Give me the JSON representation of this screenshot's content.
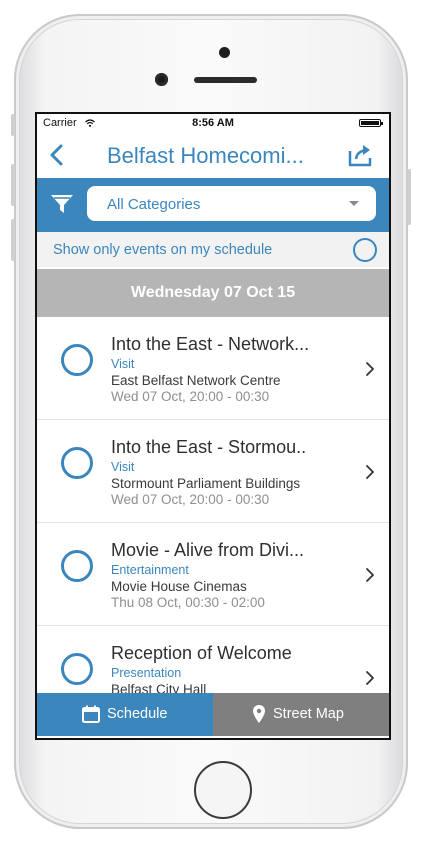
{
  "status_bar": {
    "carrier": "Carrier",
    "time": "8:56 AM"
  },
  "nav": {
    "title": "Belfast Homecomi...",
    "back_icon": "chevron-left-icon",
    "share_icon": "share-icon"
  },
  "filter": {
    "category": "All Categories",
    "icon": "funnel-icon"
  },
  "only_my_schedule": {
    "label": "Show only events on my schedule"
  },
  "date_header": "Wednesday 07 Oct 15",
  "events": [
    {
      "title": "Into the East - Network...",
      "category": "Visit",
      "venue": "East Belfast Network Centre",
      "time": "Wed 07 Oct, 20:00 - 00:30"
    },
    {
      "title": "Into the East - Stormou..",
      "category": "Visit",
      "venue": "Stormount Parliament Buildings",
      "time": "Wed 07 Oct, 20:00 - 00:30"
    },
    {
      "title": "Movie - Alive from Divi...",
      "category": "Entertainment",
      "venue": "Movie House Cinemas",
      "time": "Thu 08 Oct, 00:30 - 02:00"
    },
    {
      "title": "Reception of Welcome",
      "category": "Presentation",
      "venue": "Belfast City Hall",
      "time": ""
    }
  ],
  "tabs": {
    "schedule": "Schedule",
    "map": "Street Map"
  },
  "colors": {
    "accent": "#3b86bd",
    "date_header_bg": "#b5b5b5",
    "tab_inactive": "#7f7f7f"
  }
}
